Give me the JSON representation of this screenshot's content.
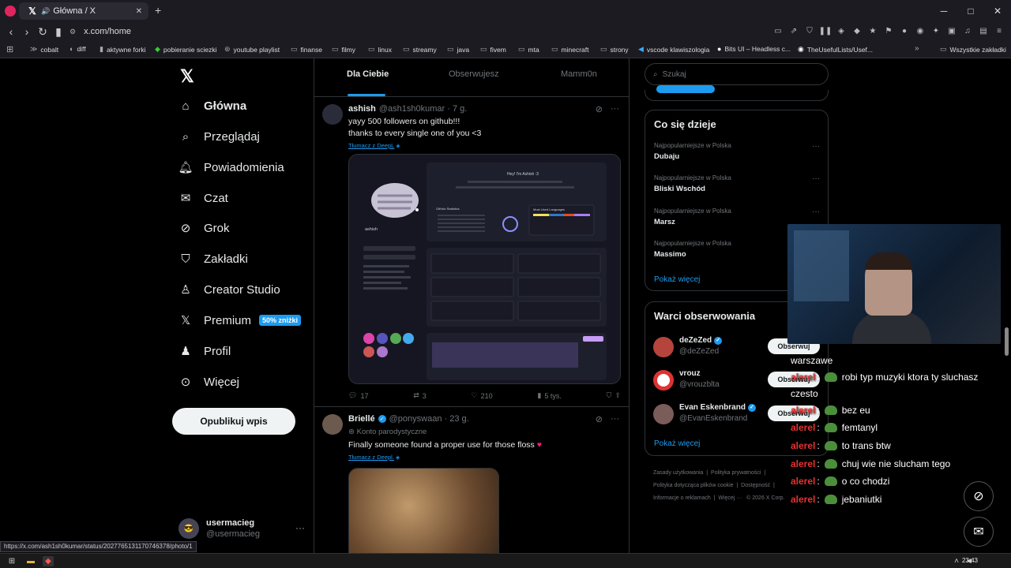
{
  "browser": {
    "tab_title": "Główna / X",
    "url": "x.com/home",
    "new_tab": "+",
    "status_url": "https://x.com/ash1sh0kumar/status/2027765131170746378/photo/1",
    "bookmarks": [
      "cobalt",
      "diff",
      "aktywne forki",
      "pobieranie sciezki",
      "youtube playlist",
      "finanse",
      "filmy",
      "linux",
      "streamy",
      "java",
      "fivem",
      "mta",
      "minecraft",
      "strony",
      "vscode klawiszologia",
      "Bits UI – Headless c...",
      "TheUsefulLists/Usef..."
    ],
    "all_bookmarks": "Wszystkie zakładki",
    "window_controls": [
      "─",
      "□",
      "✕"
    ]
  },
  "nav": {
    "items": [
      "Główna",
      "Przeglądaj",
      "Powiadomienia",
      "Czat",
      "Grok",
      "Zakładki",
      "Creator Studio",
      "Premium",
      "Profil",
      "Więcej"
    ],
    "premium_badge": "50% zniżki",
    "post_button": "Opublikuj wpis",
    "user": {
      "name": "usermacieg",
      "handle": "@usermacieg"
    }
  },
  "feed": {
    "tabs": [
      "Dla Ciebie",
      "Obserwujesz",
      "Mamm0n"
    ],
    "tweet1": {
      "name": "ashish",
      "handle": "@ash1sh0kumar · 7 g.",
      "line1": "yayy 500 followers on github!!!",
      "line2": "thanks to every single one of you <3",
      "translate": "Tłumacz z DeepL",
      "stats": {
        "replies": "17",
        "reposts": "3",
        "likes": "210",
        "views": "5 tys."
      },
      "media": {
        "greeting": "Hey! I'm Ashish :3",
        "langs_title": "Most Used Languages",
        "stats_title": "GitHub Statistics",
        "profile_name": "ashish"
      }
    },
    "tweet2": {
      "name": "Briellé",
      "handle": "@ponyswaan · 23 g.",
      "parody": "Konto parodystyczne",
      "text": "Finally someone found a proper use for those floss",
      "translate": "Tłumacz z Deepl."
    }
  },
  "right": {
    "search_placeholder": "Szukaj",
    "trending_title": "Co się dzieje",
    "trends": [
      {
        "meta": "Najpopularniejsze w Polska",
        "topic": "Dubaju"
      },
      {
        "meta": "Najpopularniejsze w Polska",
        "topic": "Bliski Wschód"
      },
      {
        "meta": "Najpopularniejsze w Polska",
        "topic": "Marsz"
      },
      {
        "meta": "Najpopularniejsze w Polska",
        "topic": "Massimo"
      }
    ],
    "show_more": "Pokaż więcej",
    "follow_title": "Warci obserwowania",
    "follow": [
      {
        "name": "deZeZed",
        "handle": "@deZeZed",
        "verified": true,
        "button": "Obserwuj"
      },
      {
        "name": "vrouz",
        "handle": "@vrouzblta",
        "verified": false,
        "button": "Obserwuj"
      },
      {
        "name": "Evan Eskenbrand",
        "handle": "@EvanEskenbrand",
        "verified": true,
        "button": "Obserwuj"
      }
    ],
    "show_more2": "Pokaż więcej",
    "footer": [
      "Zasady użytkowania",
      "Polityka prywatności",
      "Polityka dotycząca plików cookie",
      "Dostępność",
      "Informacje o reklamach",
      "Więcej ···",
      "© 2026 X Corp."
    ]
  },
  "chat": [
    {
      "user": "",
      "msg": "warszawe"
    },
    {
      "user": "alerel",
      "msg": "robi typ muzyki ktora ty sluchasz"
    },
    {
      "user": "",
      "msg": "czesto"
    },
    {
      "user": "alerel",
      "msg": "bez eu"
    },
    {
      "user": "alerel",
      "msg": "femtanyl"
    },
    {
      "user": "alerel",
      "msg": "to trans btw"
    },
    {
      "user": "alerel",
      "msg": "chuj wie nie slucham tego"
    },
    {
      "user": "alerel",
      "msg": "o co chodzi"
    },
    {
      "user": "alerel",
      "msg": "jebaniutki"
    }
  ],
  "taskbar": {
    "clock": "23:43"
  }
}
